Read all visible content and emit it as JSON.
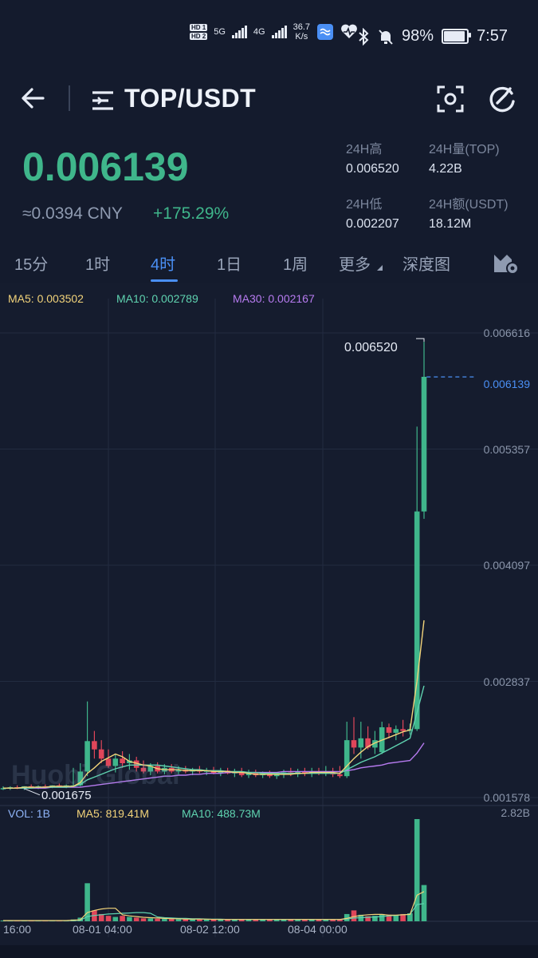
{
  "status_bar": {
    "hd1": "HD 1",
    "hd2": "HD 2",
    "sim1": "5G",
    "sim2": "4G",
    "net_speed": "36.7",
    "net_unit": "K/s",
    "battery": "98%",
    "battery_level": 0.98,
    "time": "7:57"
  },
  "header": {
    "back_icon": "back-arrow-icon",
    "menu_icon": "list-menu-icon",
    "pair": "TOP/USDT",
    "scan_icon": "scan-icon",
    "refresh_icon": "refresh-icon"
  },
  "ticker": {
    "price": "0.006139",
    "cny": "≈0.0394 CNY",
    "change": "+175.29%",
    "high_label": "24H高",
    "high_value": "0.006520",
    "low_label": "24H低",
    "low_value": "0.002207",
    "vol_label": "24H量(TOP)",
    "vol_value": "4.22B",
    "amount_label": "24H额(USDT)",
    "amount_value": "18.12M",
    "up_color": "#3fb68b",
    "down_color": "#e0465a"
  },
  "tabs": {
    "items": [
      "15分",
      "1时",
      "4时",
      "1日",
      "1周",
      "更多",
      "深度图"
    ],
    "active": "4时",
    "settings_icon": "chart-settings-icon"
  },
  "chart_data": {
    "type": "candlestick",
    "title": "",
    "interval": "4时",
    "legend": {
      "ma5": "MA5: 0.003502",
      "ma10": "MA10: 0.002789",
      "ma30": "MA30: 0.002167"
    },
    "colors": {
      "ma5": "#f2d37a",
      "ma10": "#5fd3b0",
      "ma30": "#b77bf0",
      "accent": "#4a8ff4"
    },
    "y_axis_labels": [
      "0.006616",
      "0.005357",
      "0.004097",
      "0.002837",
      "0.001578"
    ],
    "y_axis_values": [
      0.006616,
      0.005357,
      0.004097,
      0.002837,
      0.001578
    ],
    "ylim": [
      0.001578,
      0.006616
    ],
    "x_axis_labels": [
      "16:00",
      "08-01 04:00",
      "08-02 12:00",
      "08-04 00:00"
    ],
    "high_marker": "0.006520",
    "low_marker": "0.001675",
    "current_price": "0.006139",
    "candles": [
      {
        "o": 0.00168,
        "h": 0.0017,
        "l": 0.00166,
        "c": 0.00168
      },
      {
        "o": 0.00168,
        "h": 0.0017,
        "l": 0.00166,
        "c": 0.00169
      },
      {
        "o": 0.00169,
        "h": 0.00171,
        "l": 0.00167,
        "c": 0.00168
      },
      {
        "o": 0.00168,
        "h": 0.0017,
        "l": 0.00166,
        "c": 0.0017
      },
      {
        "o": 0.0017,
        "h": 0.00172,
        "l": 0.00168,
        "c": 0.00169
      },
      {
        "o": 0.00169,
        "h": 0.00171,
        "l": 0.00167,
        "c": 0.0017
      },
      {
        "o": 0.0017,
        "h": 0.00172,
        "l": 0.00168,
        "c": 0.00169
      },
      {
        "o": 0.00169,
        "h": 0.00171,
        "l": 0.00168,
        "c": 0.00171
      },
      {
        "o": 0.00171,
        "h": 0.00173,
        "l": 0.00169,
        "c": 0.0017
      },
      {
        "o": 0.0017,
        "h": 0.00172,
        "l": 0.00168,
        "c": 0.00171
      },
      {
        "o": 0.00171,
        "h": 0.0019,
        "l": 0.00169,
        "c": 0.00171
      },
      {
        "o": 0.00171,
        "h": 0.00195,
        "l": 0.0017,
        "c": 0.00186
      },
      {
        "o": 0.00186,
        "h": 0.00262,
        "l": 0.00181,
        "c": 0.00219
      },
      {
        "o": 0.00219,
        "h": 0.0023,
        "l": 0.002,
        "c": 0.0021
      },
      {
        "o": 0.0021,
        "h": 0.0022,
        "l": 0.00195,
        "c": 0.002
      },
      {
        "o": 0.002,
        "h": 0.0021,
        "l": 0.0019,
        "c": 0.00192
      },
      {
        "o": 0.00192,
        "h": 0.00205,
        "l": 0.00185,
        "c": 0.002
      },
      {
        "o": 0.002,
        "h": 0.00208,
        "l": 0.0019,
        "c": 0.00195
      },
      {
        "o": 0.00195,
        "h": 0.00205,
        "l": 0.00188,
        "c": 0.00198
      },
      {
        "o": 0.00198,
        "h": 0.00202,
        "l": 0.00186,
        "c": 0.0019
      },
      {
        "o": 0.0019,
        "h": 0.00198,
        "l": 0.00184,
        "c": 0.00186
      },
      {
        "o": 0.00186,
        "h": 0.00195,
        "l": 0.00182,
        "c": 0.00192
      },
      {
        "o": 0.00192,
        "h": 0.00196,
        "l": 0.00184,
        "c": 0.00186
      },
      {
        "o": 0.00186,
        "h": 0.00194,
        "l": 0.00183,
        "c": 0.0019
      },
      {
        "o": 0.0019,
        "h": 0.00194,
        "l": 0.00184,
        "c": 0.00186
      },
      {
        "o": 0.00186,
        "h": 0.00192,
        "l": 0.00183,
        "c": 0.00188
      },
      {
        "o": 0.00188,
        "h": 0.00192,
        "l": 0.00184,
        "c": 0.00186
      },
      {
        "o": 0.00186,
        "h": 0.0019,
        "l": 0.00182,
        "c": 0.00188
      },
      {
        "o": 0.00188,
        "h": 0.00192,
        "l": 0.00184,
        "c": 0.00186
      },
      {
        "o": 0.00186,
        "h": 0.0019,
        "l": 0.00182,
        "c": 0.00187
      },
      {
        "o": 0.00187,
        "h": 0.00191,
        "l": 0.00183,
        "c": 0.00184
      },
      {
        "o": 0.00184,
        "h": 0.0019,
        "l": 0.00181,
        "c": 0.00187
      },
      {
        "o": 0.00187,
        "h": 0.0019,
        "l": 0.00183,
        "c": 0.00184
      },
      {
        "o": 0.00184,
        "h": 0.00189,
        "l": 0.0018,
        "c": 0.00186
      },
      {
        "o": 0.00186,
        "h": 0.0019,
        "l": 0.0018,
        "c": 0.00182
      },
      {
        "o": 0.00182,
        "h": 0.00188,
        "l": 0.00179,
        "c": 0.00185
      },
      {
        "o": 0.00185,
        "h": 0.00188,
        "l": 0.0018,
        "c": 0.00182
      },
      {
        "o": 0.00182,
        "h": 0.00186,
        "l": 0.00179,
        "c": 0.00184
      },
      {
        "o": 0.00184,
        "h": 0.00187,
        "l": 0.00179,
        "c": 0.00181
      },
      {
        "o": 0.00181,
        "h": 0.00185,
        "l": 0.00178,
        "c": 0.00183
      },
      {
        "o": 0.00183,
        "h": 0.00188,
        "l": 0.00179,
        "c": 0.00185
      },
      {
        "o": 0.00185,
        "h": 0.0019,
        "l": 0.00181,
        "c": 0.00183
      },
      {
        "o": 0.00183,
        "h": 0.00189,
        "l": 0.0018,
        "c": 0.00186
      },
      {
        "o": 0.00186,
        "h": 0.0019,
        "l": 0.00181,
        "c": 0.00184
      },
      {
        "o": 0.00184,
        "h": 0.0019,
        "l": 0.0018,
        "c": 0.00186
      },
      {
        "o": 0.00186,
        "h": 0.0019,
        "l": 0.00182,
        "c": 0.00184
      },
      {
        "o": 0.00184,
        "h": 0.00192,
        "l": 0.00181,
        "c": 0.00185
      },
      {
        "o": 0.00185,
        "h": 0.0019,
        "l": 0.0018,
        "c": 0.00183
      },
      {
        "o": 0.00183,
        "h": 0.00192,
        "l": 0.00179,
        "c": 0.00181
      },
      {
        "o": 0.00181,
        "h": 0.0024,
        "l": 0.00179,
        "c": 0.0022
      },
      {
        "o": 0.0022,
        "h": 0.00245,
        "l": 0.00205,
        "c": 0.00212
      },
      {
        "o": 0.00212,
        "h": 0.0024,
        "l": 0.002,
        "c": 0.00222
      },
      {
        "o": 0.00222,
        "h": 0.00235,
        "l": 0.0021,
        "c": 0.00212
      },
      {
        "o": 0.00212,
        "h": 0.0023,
        "l": 0.00205,
        "c": 0.0022
      },
      {
        "o": 0.00207,
        "h": 0.0024,
        "l": 0.00205,
        "c": 0.00234
      },
      {
        "o": 0.00234,
        "h": 0.00238,
        "l": 0.00222,
        "c": 0.00228
      },
      {
        "o": 0.00228,
        "h": 0.00236,
        "l": 0.0022,
        "c": 0.00232
      },
      {
        "o": 0.00232,
        "h": 0.00242,
        "l": 0.00224,
        "c": 0.0023
      },
      {
        "o": 0.0023,
        "h": 0.00238,
        "l": 0.00226,
        "c": 0.00232
      },
      {
        "o": 0.00232,
        "h": 0.0056,
        "l": 0.0023,
        "c": 0.00468
      },
      {
        "o": 0.00468,
        "h": 0.00652,
        "l": 0.0046,
        "c": 0.00614
      }
    ],
    "ma5": [
      0.00168,
      0.00168,
      0.00168,
      0.00169,
      0.00169,
      0.00169,
      0.00169,
      0.0017,
      0.0017,
      0.0017,
      0.0017,
      0.00174,
      0.00184,
      0.0019,
      0.00197,
      0.00201,
      0.00205,
      0.00202,
      0.00197,
      0.00195,
      0.00193,
      0.00192,
      0.00189,
      0.00188,
      0.00188,
      0.00188,
      0.00187,
      0.00187,
      0.00187,
      0.00187,
      0.00186,
      0.00186,
      0.00186,
      0.00185,
      0.00185,
      0.00184,
      0.00183,
      0.00183,
      0.00183,
      0.00183,
      0.00183,
      0.00183,
      0.00184,
      0.00184,
      0.00185,
      0.00185,
      0.00185,
      0.00185,
      0.00184,
      0.00192,
      0.002,
      0.00207,
      0.00213,
      0.00217,
      0.0022,
      0.00223,
      0.00226,
      0.00229,
      0.00231,
      0.00284,
      0.0035
    ],
    "ma10": [
      0.00168,
      0.00168,
      0.00168,
      0.00168,
      0.00168,
      0.00169,
      0.00169,
      0.00169,
      0.00169,
      0.00169,
      0.0017,
      0.00172,
      0.00177,
      0.0018,
      0.00183,
      0.00186,
      0.00189,
      0.00191,
      0.00193,
      0.00193,
      0.00193,
      0.00193,
      0.00193,
      0.00192,
      0.00191,
      0.0019,
      0.00189,
      0.00188,
      0.00188,
      0.00187,
      0.00187,
      0.00187,
      0.00186,
      0.00186,
      0.00186,
      0.00185,
      0.00185,
      0.00184,
      0.00184,
      0.00184,
      0.00184,
      0.00184,
      0.00184,
      0.00184,
      0.00184,
      0.00184,
      0.00184,
      0.00184,
      0.00184,
      0.00188,
      0.00192,
      0.00196,
      0.00199,
      0.00202,
      0.00206,
      0.0021,
      0.00214,
      0.00218,
      0.00222,
      0.0025,
      0.00279
    ],
    "ma30": [
      0.00168,
      0.00168,
      0.00168,
      0.00168,
      0.00168,
      0.00168,
      0.00168,
      0.00169,
      0.00169,
      0.00169,
      0.00169,
      0.00169,
      0.0017,
      0.00171,
      0.00172,
      0.00173,
      0.00174,
      0.00175,
      0.00176,
      0.00177,
      0.00178,
      0.00179,
      0.0018,
      0.00181,
      0.00181,
      0.00182,
      0.00182,
      0.00183,
      0.00183,
      0.00184,
      0.00184,
      0.00184,
      0.00185,
      0.00185,
      0.00185,
      0.00185,
      0.00185,
      0.00185,
      0.00185,
      0.00185,
      0.00186,
      0.00186,
      0.00186,
      0.00186,
      0.00186,
      0.00186,
      0.00186,
      0.00186,
      0.00186,
      0.00187,
      0.00188,
      0.0019,
      0.00191,
      0.00192,
      0.00193,
      0.00195,
      0.00196,
      0.00197,
      0.00198,
      0.00206,
      0.00217
    ]
  },
  "volume": {
    "legend_vol": "VOL: 1B",
    "legend_ma5": "MA5: 819.41M",
    "legend_ma10": "MA10: 488.73M",
    "max_label": "2.82B",
    "max_value": 2.82,
    "values": [
      0.02,
      0.02,
      0.02,
      0.02,
      0.02,
      0.02,
      0.02,
      0.02,
      0.02,
      0.02,
      0.05,
      0.1,
      1.05,
      0.3,
      0.2,
      0.15,
      0.12,
      0.15,
      0.12,
      0.1,
      0.08,
      0.08,
      0.07,
      0.07,
      0.06,
      0.06,
      0.06,
      0.06,
      0.05,
      0.05,
      0.05,
      0.05,
      0.05,
      0.05,
      0.05,
      0.05,
      0.05,
      0.05,
      0.05,
      0.05,
      0.05,
      0.05,
      0.05,
      0.05,
      0.05,
      0.05,
      0.05,
      0.05,
      0.05,
      0.2,
      0.3,
      0.18,
      0.14,
      0.15,
      0.2,
      0.18,
      0.16,
      0.2,
      0.22,
      2.82,
      1.0
    ],
    "ma5": [
      0.02,
      0.02,
      0.02,
      0.02,
      0.02,
      0.02,
      0.02,
      0.02,
      0.02,
      0.02,
      0.03,
      0.04,
      0.24,
      0.3,
      0.34,
      0.36,
      0.36,
      0.18,
      0.15,
      0.13,
      0.11,
      0.1,
      0.09,
      0.08,
      0.07,
      0.07,
      0.06,
      0.06,
      0.06,
      0.06,
      0.05,
      0.05,
      0.05,
      0.05,
      0.05,
      0.05,
      0.05,
      0.05,
      0.05,
      0.05,
      0.05,
      0.05,
      0.05,
      0.05,
      0.05,
      0.05,
      0.05,
      0.05,
      0.05,
      0.08,
      0.13,
      0.16,
      0.18,
      0.19,
      0.19,
      0.17,
      0.17,
      0.18,
      0.19,
      0.72,
      0.82
    ],
    "ma10": [
      0.02,
      0.02,
      0.02,
      0.02,
      0.02,
      0.02,
      0.02,
      0.02,
      0.02,
      0.02,
      0.02,
      0.03,
      0.13,
      0.16,
      0.18,
      0.2,
      0.21,
      0.22,
      0.23,
      0.24,
      0.24,
      0.22,
      0.12,
      0.1,
      0.09,
      0.08,
      0.08,
      0.07,
      0.07,
      0.06,
      0.06,
      0.06,
      0.05,
      0.05,
      0.05,
      0.05,
      0.05,
      0.05,
      0.05,
      0.05,
      0.05,
      0.05,
      0.05,
      0.05,
      0.05,
      0.05,
      0.05,
      0.05,
      0.05,
      0.06,
      0.09,
      0.1,
      0.11,
      0.12,
      0.13,
      0.15,
      0.16,
      0.18,
      0.19,
      0.46,
      0.49
    ]
  },
  "watermark": "Huobi Global"
}
